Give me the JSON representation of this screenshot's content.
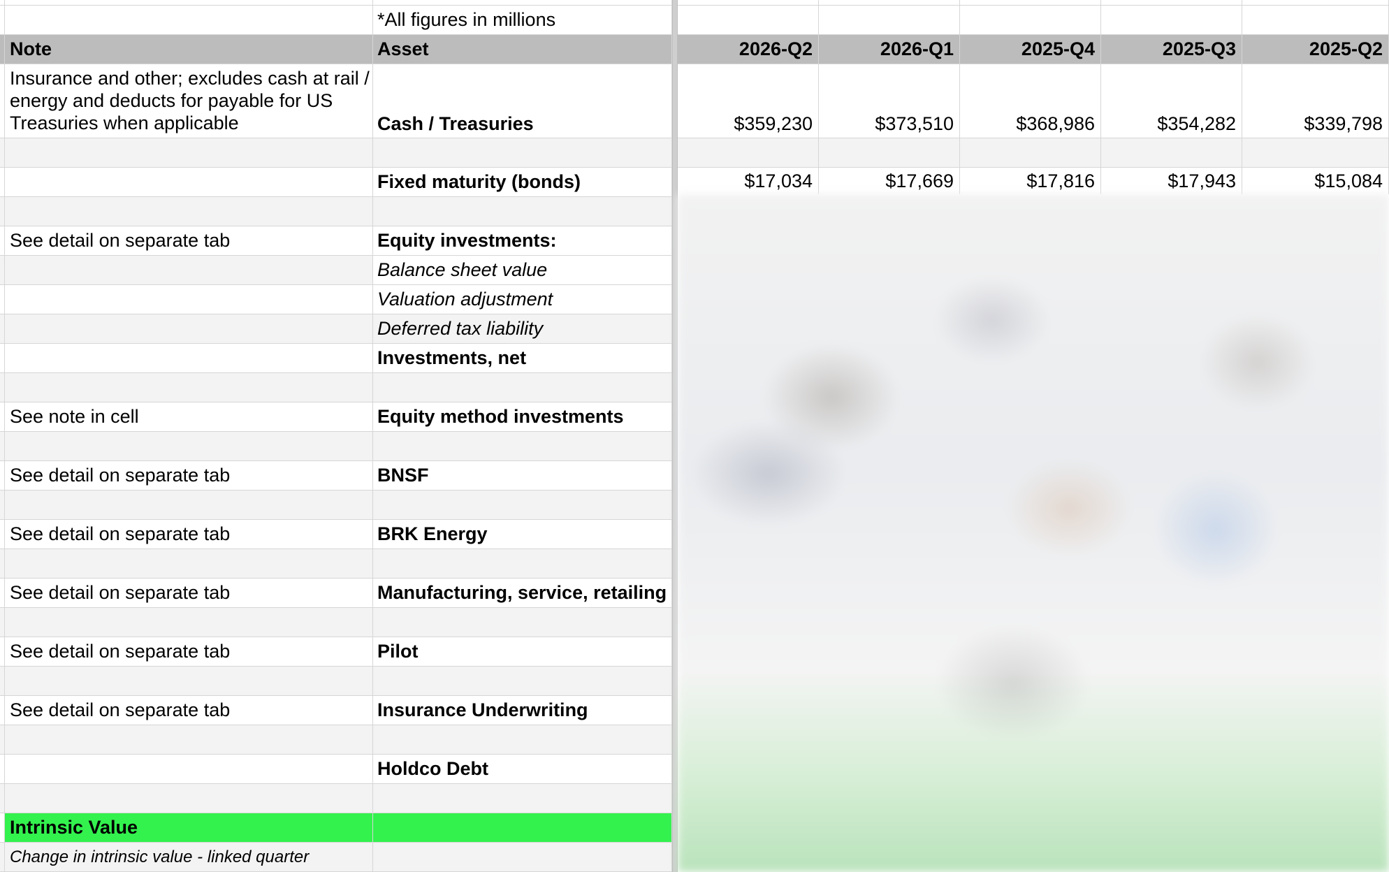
{
  "sheet": {
    "top_note": "*All figures in millions",
    "headers": {
      "note": "Note",
      "asset": "Asset"
    },
    "quarters": [
      "2026-Q2",
      "2026-Q1",
      "2025-Q4",
      "2025-Q3",
      "2025-Q2"
    ],
    "cash": {
      "note": "Insurance and other; excludes cash at rail / energy and deducts for payable for US Treasuries when applicable",
      "asset": "Cash / Treasuries",
      "values": [
        "$359,230",
        "$373,510",
        "$368,986",
        "$354,282",
        "$339,798"
      ]
    },
    "bonds": {
      "asset": "Fixed maturity (bonds)",
      "values": [
        "$17,034",
        "$17,669",
        "$17,816",
        "$17,943",
        "$15,084"
      ]
    },
    "equity": {
      "note": "See detail on separate tab",
      "asset": "Equity investments:",
      "balance": "Balance sheet value",
      "valuation": "Valuation adjustment",
      "deferred": "Deferred tax liability",
      "net": "Investments, net"
    },
    "equity_method": {
      "note": "See note in cell",
      "asset": "Equity method investments"
    },
    "bnsf": {
      "note": "See detail on separate tab",
      "asset": "BNSF"
    },
    "brk_energy": {
      "note": "See detail on separate tab",
      "asset": "BRK Energy"
    },
    "msr": {
      "note": "See detail on separate tab",
      "asset": "Manufacturing, service, retailing"
    },
    "pilot": {
      "note": "See detail on separate tab",
      "asset": "Pilot"
    },
    "insurance": {
      "note": "See detail on separate tab",
      "asset": "Insurance Underwriting"
    },
    "holdco": {
      "asset": "Holdco Debt"
    },
    "intrinsic": {
      "label": "Intrinsic Value"
    },
    "change": {
      "label": "Change in intrinsic value - linked quarter"
    },
    "colors": {
      "header_bg": "#bcbcbc",
      "alt_row_bg": "#f3f3f3",
      "intrinsic_bg": "#33f24e"
    }
  }
}
